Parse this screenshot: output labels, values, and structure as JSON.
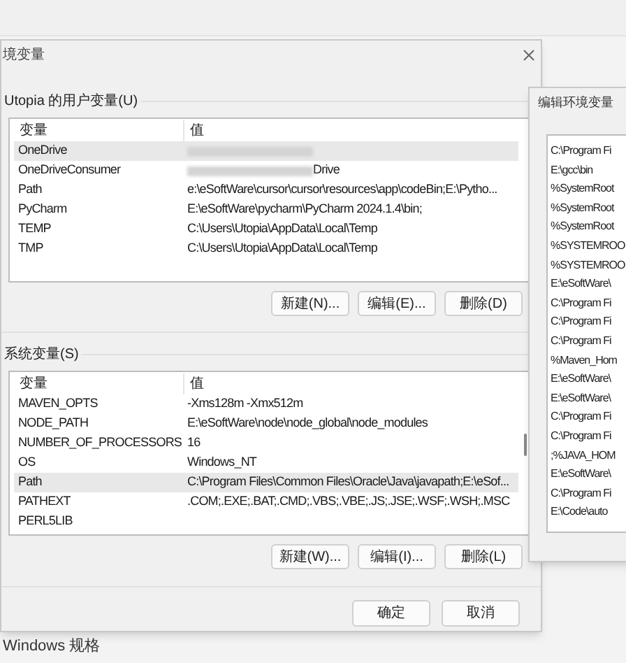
{
  "window": {
    "title": "境变量"
  },
  "user_vars": {
    "label": "Utopia 的用户变量(U)",
    "columns": [
      "变量",
      "值"
    ],
    "rows": [
      {
        "name": "OneDrive",
        "value": "",
        "redacted": true,
        "selected": true
      },
      {
        "name": "OneDriveConsumer",
        "value": "Drive",
        "redacted": true,
        "selected": false
      },
      {
        "name": "Path",
        "value": "e:\\eSoftWare\\cursor\\cursor\\resources\\app\\codeBin;E:\\Pytho...",
        "redacted": false,
        "selected": false
      },
      {
        "name": "PyCharm",
        "value": "E:\\eSoftWare\\pycharm\\PyCharm 2024.1.4\\bin;",
        "redacted": false,
        "selected": false
      },
      {
        "name": "TEMP",
        "value": "C:\\Users\\Utopia\\AppData\\Local\\Temp",
        "redacted": false,
        "selected": false
      },
      {
        "name": "TMP",
        "value": "C:\\Users\\Utopia\\AppData\\Local\\Temp",
        "redacted": false,
        "selected": false
      }
    ],
    "buttons": [
      "新建(N)...",
      "编辑(E)...",
      "删除(D)"
    ]
  },
  "system_vars": {
    "label": "系统变量(S)",
    "columns": [
      "变量",
      "值"
    ],
    "rows": [
      {
        "name": "MAVEN_OPTS",
        "value": "-Xms128m -Xmx512m",
        "selected": false
      },
      {
        "name": "NODE_PATH",
        "value": "E:\\eSoftWare\\node\\node_global\\node_modules",
        "selected": false
      },
      {
        "name": "NUMBER_OF_PROCESSORS",
        "value": "16",
        "selected": false
      },
      {
        "name": "OS",
        "value": "Windows_NT",
        "selected": false
      },
      {
        "name": "Path",
        "value": "C:\\Program Files\\Common Files\\Oracle\\Java\\javapath;E:\\eSof...",
        "selected": true
      },
      {
        "name": "PATHEXT",
        "value": ".COM;.EXE;.BAT;.CMD;.VBS;.VBE;.JS;.JSE;.WSF;.WSH;.MSC",
        "selected": false
      },
      {
        "name": "PERL5LIB",
        "value": "",
        "selected": false
      }
    ],
    "buttons": [
      "新建(W)...",
      "编辑(I)...",
      "删除(L)"
    ]
  },
  "dialog_buttons": [
    "确定",
    "取消"
  ],
  "edit_dialog": {
    "title": "编辑环境变量",
    "items": [
      "C:\\Program Fi",
      "E:\\gcc\\bin",
      "%SystemRoot",
      "%SystemRoot",
      "%SystemRoot",
      "%SYSTEMROO",
      "%SYSTEMROO",
      "E:\\eSoftWare\\",
      "C:\\Program Fi",
      "C:\\Program Fi",
      "C:\\Program Fi",
      "%Maven_Hom",
      "E:\\eSoftWare\\",
      "E:\\eSoftWare\\",
      "C:\\Program Fi",
      "C:\\Program Fi",
      ";%JAVA_HOM",
      "E:\\eSoftWare\\",
      "C:\\Program Fi",
      "E:\\Code\\auto"
    ]
  },
  "background_text": "Windows 规格"
}
